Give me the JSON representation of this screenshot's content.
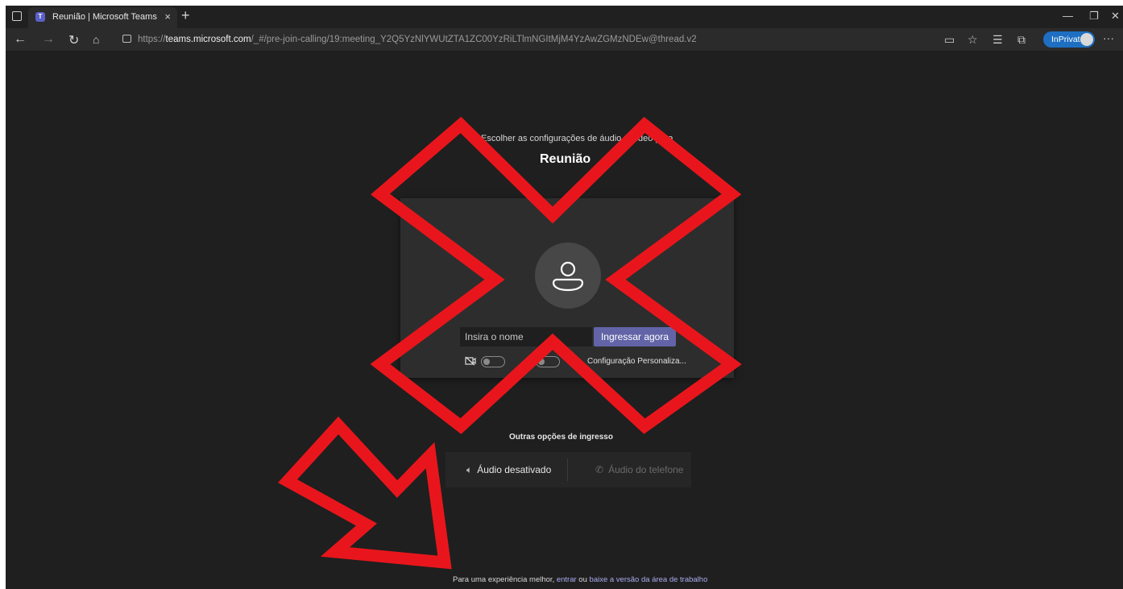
{
  "browser": {
    "tab_title": "Reunião | Microsoft Teams",
    "tab_close": "×",
    "new_tab": "+",
    "url_scheme": "https://",
    "url_host": "teams.microsoft.com",
    "url_path": "/_#/pre-join-calling/19:meeting_Y2Q5YzNlYWUtZTA1ZC00YzRiLTlmNGItMjM4YzAwZGMzNDEw@thread.v2",
    "inprivate_label": "InPrivate",
    "more": "···"
  },
  "prejoin": {
    "subtitle": "Escolher as configurações de áudio e vídeo para",
    "title": "Reunião",
    "name_placeholder": "Insira o nome",
    "join_button": "Ingressar agora",
    "custom_setting": "Configuração Personaliza..."
  },
  "other_options": {
    "title": "Outras opções de ingresso",
    "audio_off": "Áudio desativado",
    "phone_audio": "Áudio do telefone"
  },
  "footer": {
    "prefix": "Para uma experiência melhor, ",
    "signin_link": "entrar",
    "middle": " ou ",
    "download_link": "baixe a versão da área de trabalho"
  },
  "colors": {
    "page_bg": "#1f1f1f",
    "accent": "#6264a7",
    "annotation_red": "#e8161c",
    "link": "#a9abf0"
  },
  "icons": [
    "tab-actions-icon",
    "teams-favicon",
    "back-icon",
    "forward-icon",
    "refresh-icon",
    "home-icon",
    "lock-icon",
    "immersive-reader-icon",
    "favorite-add-icon",
    "favorites-icon",
    "collections-icon",
    "person-icon",
    "camera-off-icon",
    "speaker-mute-icon",
    "phone-icon"
  ]
}
